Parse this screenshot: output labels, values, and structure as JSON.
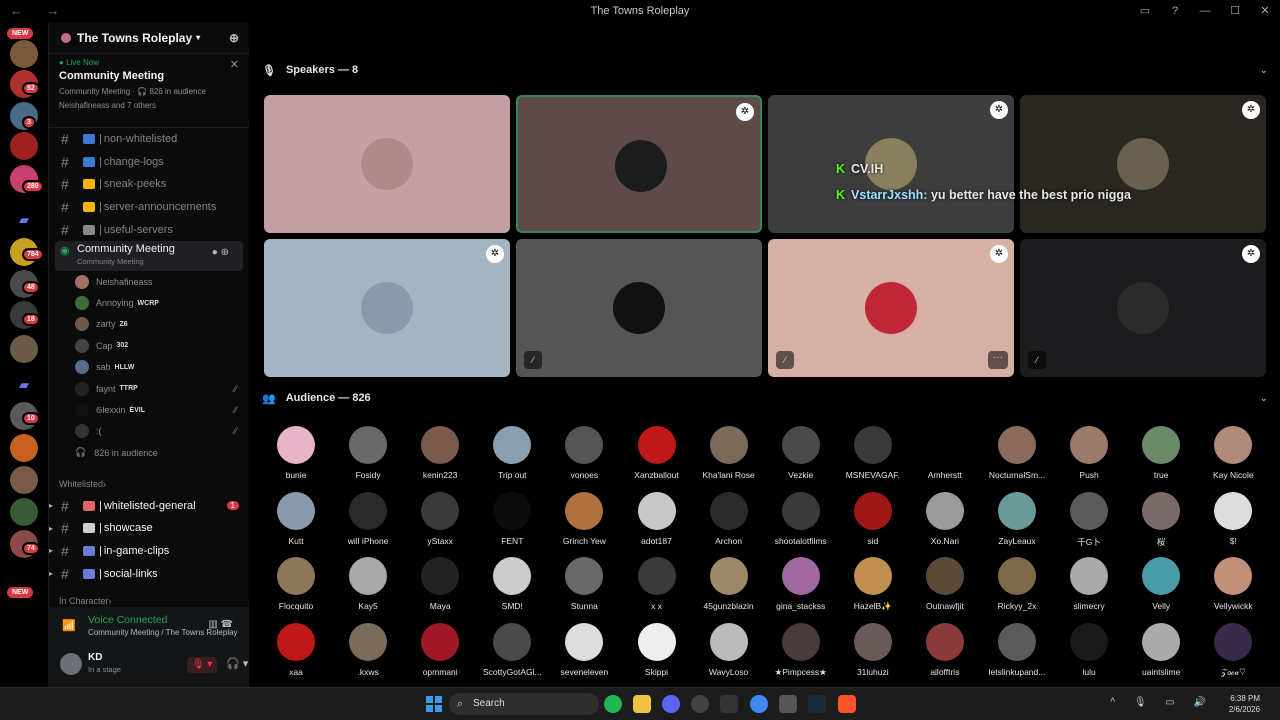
{
  "window": {
    "title": "The Towns Roleplay",
    "controls": [
      "▭",
      "?",
      "—",
      "☐",
      "✕"
    ]
  },
  "rail": {
    "new_top": "NEW",
    "new_bottom": "NEW",
    "badges": [
      "52",
      "3",
      "289",
      "784",
      "48",
      "18",
      "10",
      "74"
    ]
  },
  "server": {
    "name": "The Towns Roleplay"
  },
  "stage": {
    "live_label": "Live Now",
    "title": "Community Meeting",
    "sub": "Community Meeting · 🎧 826 in audience",
    "who": "Neishafineass and 7 others"
  },
  "channels": [
    {
      "label": "non-whitelisted",
      "emoji_color": "#3a7bd5"
    },
    {
      "label": "change-logs",
      "emoji_color": "#3a7bd5"
    },
    {
      "label": "sneak-peeks",
      "emoji_color": "#f4b400"
    },
    {
      "label": "server-announcements",
      "emoji_color": "#f4b400"
    },
    {
      "label": "useful-servers",
      "emoji_color": "#888888"
    }
  ],
  "voice_channel": {
    "name": "Community Meeting",
    "sub": "Community Meeting"
  },
  "members": [
    {
      "name": "Neishafineass",
      "tag": "",
      "color": "#a07060",
      "muted": false
    },
    {
      "name": "Annoying",
      "tag": "WCRP",
      "color": "#3c6e3c",
      "muted": false
    },
    {
      "name": "zarty",
      "tag": "Z6",
      "color": "#6a5a4a",
      "muted": false
    },
    {
      "name": "Cap",
      "tag": "302",
      "color": "#444",
      "muted": false
    },
    {
      "name": "sab",
      "tag": "HLLW",
      "color": "#5a6a8a",
      "muted": false
    },
    {
      "name": "faynt",
      "tag": "TTRP",
      "color": "#222",
      "muted": true
    },
    {
      "name": "𝔊lexxin",
      "tag": "ÉVIL",
      "color": "#111",
      "muted": true
    },
    {
      "name": ":(",
      "tag": "",
      "color": "#333",
      "muted": true
    }
  ],
  "audience_count_label": "826 in audience",
  "category_whitelisted": "Whitelisted",
  "whitelisted_channels": [
    {
      "label": "whitelisted-general",
      "ping": "1",
      "emoji_color": "#e06666"
    },
    {
      "label": "showcase",
      "ping": "",
      "emoji_color": "#d0d0d0"
    },
    {
      "label": "in-game-clips",
      "ping": "",
      "emoji_color": "#6a7bd5"
    },
    {
      "label": "social-links",
      "ping": "",
      "emoji_color": "#6a7bd5"
    }
  ],
  "category_incharacter": "In Character",
  "voice_connected": {
    "status": "Voice Connected",
    "where": "Community Meeting / The Towns Roleplay"
  },
  "user": {
    "name": "KD",
    "status": "In a stage"
  },
  "speakers_header": "Speakers — 8",
  "audience_header": "Audience — 826",
  "speakers": [
    {
      "bg": "#c4a0a4",
      "avatar": "#b08a8a",
      "mod": false,
      "muted": false,
      "active": false,
      "more": false
    },
    {
      "bg": "#5e4a48",
      "avatar": "#1c1c1c",
      "mod": true,
      "muted": false,
      "active": true,
      "more": false
    },
    {
      "bg": "#3d3d3d",
      "avatar": "#8a8060",
      "mod": true,
      "muted": false,
      "active": false,
      "more": false
    },
    {
      "bg": "#2a2620",
      "avatar": "#6a6050",
      "mod": true,
      "muted": false,
      "active": false,
      "more": false
    },
    {
      "bg": "#a4b4c0",
      "avatar": "#8a9aaa",
      "mod": true,
      "muted": false,
      "active": false,
      "more": false
    },
    {
      "bg": "#555555",
      "avatar": "#111111",
      "mod": false,
      "muted": true,
      "active": false,
      "more": false
    },
    {
      "bg": "#d6b0a4",
      "avatar": "#c0283a",
      "mod": true,
      "muted": true,
      "active": false,
      "more": true
    },
    {
      "bg": "#1c1c1e",
      "avatar": "#2a2a2a",
      "mod": true,
      "muted": true,
      "active": false,
      "more": false
    }
  ],
  "overlay": {
    "line1": "CV.IH",
    "line2_user": "VstarrJxshh:",
    "line2_msg": "yu better have the best prio nigga"
  },
  "audience": [
    {
      "n": "bunie",
      "c": "#e8b4c8"
    },
    {
      "n": "Fosidy",
      "c": "#6a6a6a"
    },
    {
      "n": "kenin223",
      "c": "#7a5a4a"
    },
    {
      "n": "Trip out",
      "c": "#8aa0b0"
    },
    {
      "n": "vonoes",
      "c": "#555"
    },
    {
      "n": "Xanzballout",
      "c": "#c01818"
    },
    {
      "n": "Kha'lani Rose",
      "c": "#7a6a5a"
    },
    {
      "n": "Vezkie",
      "c": "#4a4a4a"
    },
    {
      "n": "MSNEVAGAF.",
      "c": "#3a3a3a"
    },
    {
      "n": "Amherstt",
      "c": "#000"
    },
    {
      "n": "NocturnalSm...",
      "c": "#8a6a5a"
    },
    {
      "n": "Push",
      "c": "#9a7a6a"
    },
    {
      "n": "true",
      "c": "#6a8a6a"
    },
    {
      "n": "Kay Nicole",
      "c": "#b08a7a"
    },
    {
      "n": "Kutt",
      "c": "#8a9aaa"
    },
    {
      "n": "will iPhone",
      "c": "#2a2a2a"
    },
    {
      "n": "yStaxx",
      "c": "#3a3a3a"
    },
    {
      "n": "FENT",
      "c": "#0c0c0c"
    },
    {
      "n": "Grinch Yew",
      "c": "#b07040"
    },
    {
      "n": "adot187",
      "c": "#c8c8c8"
    },
    {
      "n": "Archon",
      "c": "#2a2a2a"
    },
    {
      "n": "shootalotfilms",
      "c": "#3a3a3a"
    },
    {
      "n": "sid",
      "c": "#a01818"
    },
    {
      "n": "Xo.Nari",
      "c": "#9a9a9a"
    },
    {
      "n": "ZayLeaux",
      "c": "#6a9a9a"
    },
    {
      "n": "千G卜",
      "c": "#5a5a5a"
    },
    {
      "n": "桜",
      "c": "#7a6a6a"
    },
    {
      "n": "$!",
      "c": "#ddd"
    },
    {
      "n": "Flocquito",
      "c": "#8a7a5a"
    },
    {
      "n": "Kay5",
      "c": "#aaa"
    },
    {
      "n": "Maya",
      "c": "#222"
    },
    {
      "n": "SMD!",
      "c": "#ccc"
    },
    {
      "n": "Stunna",
      "c": "#6a6a6a"
    },
    {
      "n": "x x",
      "c": "#3a3a3a"
    },
    {
      "n": "45gunzblazin",
      "c": "#9a8a6a"
    },
    {
      "n": "gina_stackss",
      "c": "#a06aa0"
    },
    {
      "n": "HazelB✨",
      "c": "#c09050"
    },
    {
      "n": "Outnawfjit",
      "c": "#5a4a3a"
    },
    {
      "n": "Rickyy_2x",
      "c": "#7a6a4a"
    },
    {
      "n": "slimecry",
      "c": "#aaa"
    },
    {
      "n": "Velly",
      "c": "#4a9aaa"
    },
    {
      "n": "Vellywickk",
      "c": "#c0907a"
    },
    {
      "n": "xaa",
      "c": "#c01818"
    },
    {
      "n": ".kxws",
      "c": "#7a6a5a"
    },
    {
      "n": "opmmani",
      "c": "#a01828"
    },
    {
      "n": "ScottyGotAGl...",
      "c": "#4a4a4a"
    },
    {
      "n": "seveneleven",
      "c": "#ddd"
    },
    {
      "n": "Skippi",
      "c": "#eee"
    },
    {
      "n": "WavyLoso",
      "c": "#bbb"
    },
    {
      "n": "★Pimpcess★",
      "c": "#4a3a3a"
    },
    {
      "n": "31luhuzi",
      "c": "#6a5a5a"
    },
    {
      "n": "allofftris",
      "c": "#8a3a3a"
    },
    {
      "n": "letslinkupand...",
      "c": "#5a5a5a"
    },
    {
      "n": "lulu",
      "c": "#1a1a1a"
    },
    {
      "n": "uaintslime",
      "c": "#aaa"
    },
    {
      "n": "𝒵𝑜𝒸𝒶♡",
      "c": "#3a2a4a"
    }
  ],
  "taskbar": {
    "search": "Search",
    "time": "6:38 PM",
    "date": "2/6/2026"
  }
}
